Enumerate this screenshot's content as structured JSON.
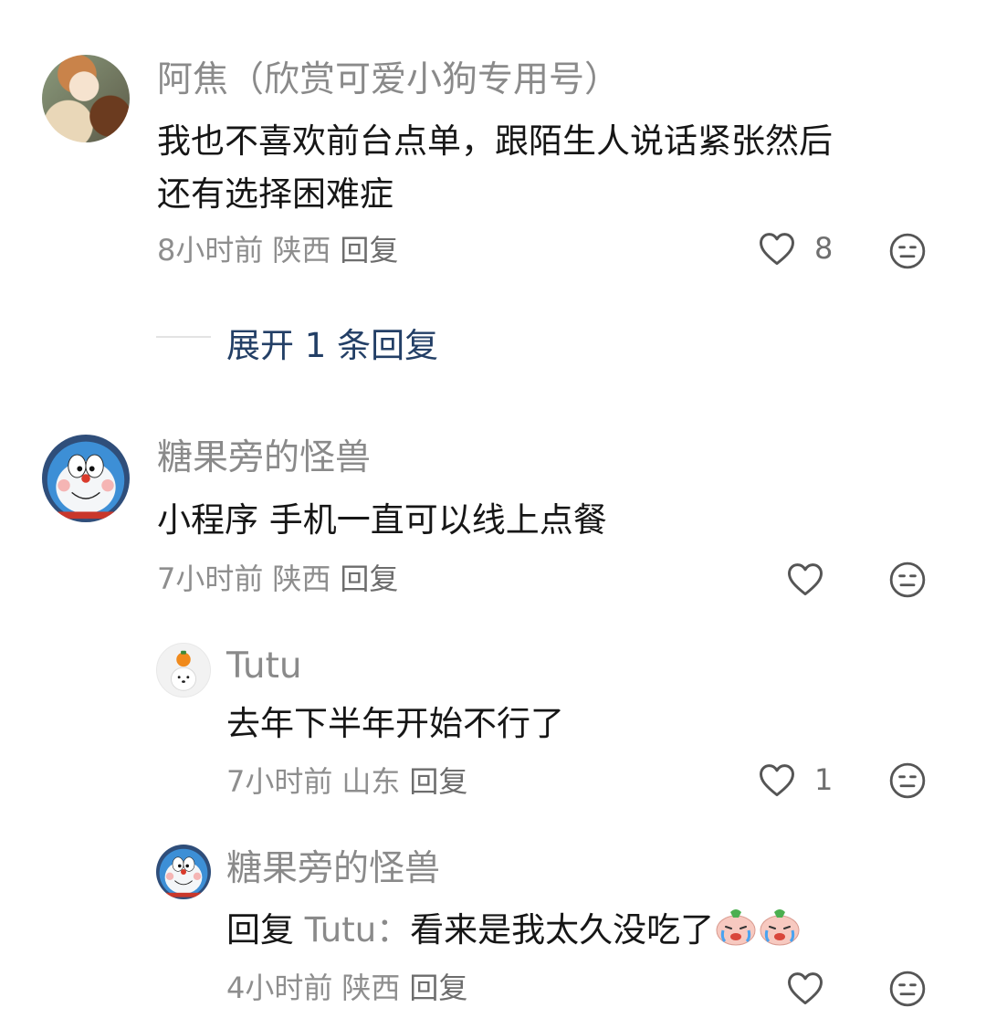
{
  "comments": [
    {
      "username": "阿焦（欣赏可爱小狗专用号）",
      "text_line1": "我也不喜欢前台点单，跟陌生人说话紧张然后",
      "text_line2": "还有选择困难症",
      "time": "8小时前",
      "region": "陕西",
      "reply_label": "回复",
      "likes": "8",
      "expand_label": "展开 1 条回复"
    },
    {
      "username": "糖果旁的怪兽",
      "text": "小程序 手机一直可以线上点餐",
      "time": "7小时前",
      "region": "陕西",
      "reply_label": "回复"
    }
  ],
  "replies": [
    {
      "username": "Tutu",
      "text": "去年下半年开始不行了",
      "time": "7小时前",
      "region": "山东",
      "reply_label": "回复",
      "likes": "1"
    },
    {
      "username": "糖果旁的怪兽",
      "reply_prefix": "回复",
      "reply_target": "Tutu：",
      "text": "看来是我太久没吃了",
      "time": "4小时前",
      "region": "陕西",
      "reply_label": "回复"
    }
  ],
  "colors": {
    "username": "#8a8a8a",
    "text": "#161616",
    "meta": "#8e8e8e",
    "expand_link": "#233f66"
  },
  "icons": [
    "heart-icon",
    "meh-face-icon",
    "crying-emoji"
  ]
}
